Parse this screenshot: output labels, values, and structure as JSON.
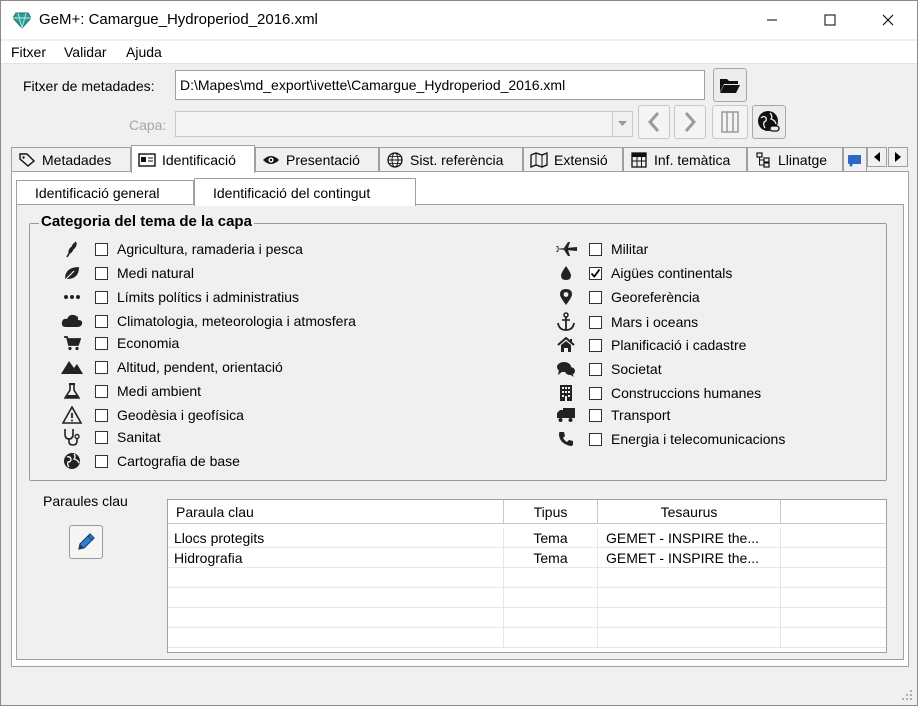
{
  "window": {
    "title": "GeM+: Camargue_Hydroperiod_2016.xml"
  },
  "menu": [
    "Fitxer",
    "Validar",
    "Ajuda"
  ],
  "metadata_file": {
    "label": "Fitxer de metadades:",
    "value": "D:\\Mapes\\md_export\\ivette\\Camargue_Hydroperiod_2016.xml"
  },
  "layer": {
    "label": "Capa:",
    "value": ""
  },
  "tabs": [
    {
      "label": "Metadades",
      "icon": "tag-icon"
    },
    {
      "label": "Identificació",
      "icon": "id-card-icon",
      "active": true
    },
    {
      "label": "Presentació",
      "icon": "eye-icon"
    },
    {
      "label": "Sist. referència",
      "icon": "globe-icon"
    },
    {
      "label": "Extensió",
      "icon": "map-icon"
    },
    {
      "label": "Inf. temàtica",
      "icon": "table-icon"
    },
    {
      "label": "Llinatge",
      "icon": "tree-icon"
    }
  ],
  "subtabs": [
    {
      "label": "Identificació general",
      "active": false
    },
    {
      "label": "Identificació del contingut",
      "active": true
    }
  ],
  "category_group": {
    "title": "Categoria del tema de la capa",
    "left": [
      {
        "label": "Agricultura, ramaderia i pesca",
        "icon": "wheat-icon",
        "checked": false
      },
      {
        "label": "Medi natural",
        "icon": "leaf-icon",
        "checked": false
      },
      {
        "label": "Límits polítics i administratius",
        "icon": "dots-icon",
        "checked": false
      },
      {
        "label": "Climatologia, meteorologia i atmosfera",
        "icon": "cloud-icon",
        "checked": false
      },
      {
        "label": "Economia",
        "icon": "cart-icon",
        "checked": false
      },
      {
        "label": "Altitud, pendent, orientació",
        "icon": "mountain-icon",
        "checked": false
      },
      {
        "label": "Medi ambient",
        "icon": "flask-icon",
        "checked": false
      },
      {
        "label": "Geodèsia i geofísica",
        "icon": "warning-triangle-icon",
        "checked": false
      },
      {
        "label": "Sanitat",
        "icon": "stethoscope-icon",
        "checked": false
      },
      {
        "label": "Cartografia de base",
        "icon": "globe-icon",
        "checked": false
      }
    ],
    "right": [
      {
        "label": "Militar",
        "icon": "plane-icon",
        "checked": false
      },
      {
        "label": "Aigües continentals",
        "icon": "water-drop-icon",
        "checked": true
      },
      {
        "label": "Georeferència",
        "icon": "map-pin-icon",
        "checked": false
      },
      {
        "label": "Mars i oceans",
        "icon": "anchor-icon",
        "checked": false
      },
      {
        "label": "Planificació i cadastre",
        "icon": "house-icon",
        "checked": false
      },
      {
        "label": "Societat",
        "icon": "comments-icon",
        "checked": false
      },
      {
        "label": "Construccions humanes",
        "icon": "building-icon",
        "checked": false
      },
      {
        "label": "Transport",
        "icon": "truck-icon",
        "checked": false
      },
      {
        "label": "Energia i telecomunicacions",
        "icon": "phone-icon",
        "checked": false
      }
    ]
  },
  "keywords": {
    "label": "Paraules clau",
    "columns": [
      "Paraula clau",
      "Tipus",
      "Tesaurus"
    ],
    "rows": [
      [
        "Llocs protegits",
        "Tema",
        "GEMET - INSPIRE the..."
      ],
      [
        "Hidrografia",
        "Tema",
        "GEMET - INSPIRE the..."
      ]
    ]
  },
  "colors": {
    "window_bg": "#f0f0f0",
    "title_bg": "#ffffff",
    "border": "#a0a0a0",
    "app_icon": "#2e9e9a"
  }
}
